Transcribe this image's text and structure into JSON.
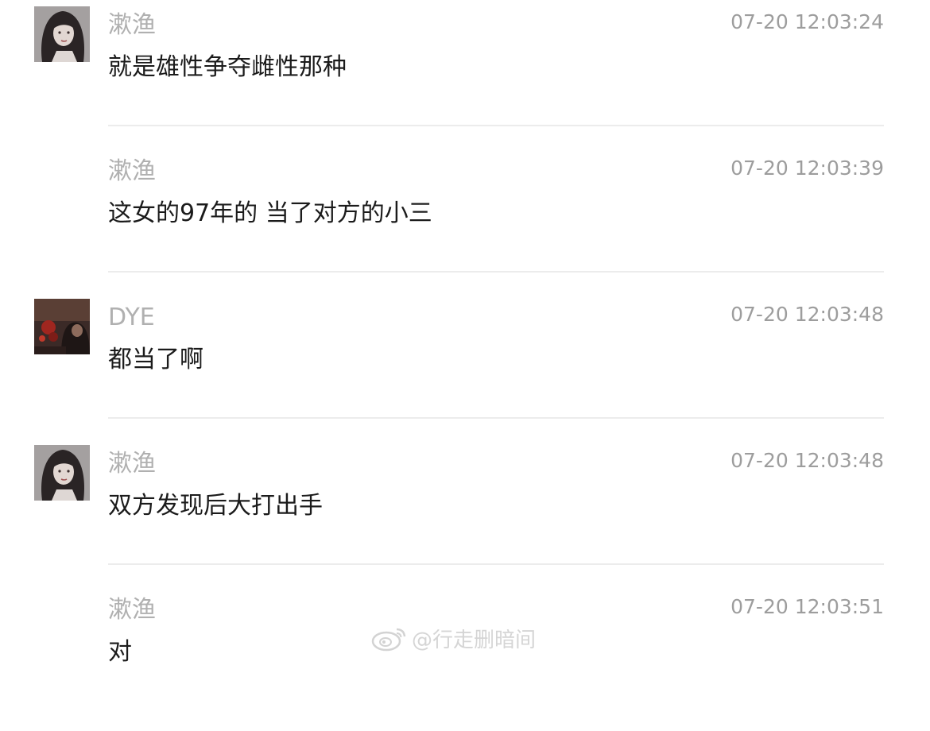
{
  "messages": [
    {
      "sender": "漱渔",
      "time": "07-20 12:03:24",
      "text": "就是雄性争夺雌性那种",
      "avatar": "avatar-dark-hair-woman",
      "show_avatar": true
    },
    {
      "sender": "漱渔",
      "time": "07-20 12:03:39",
      "text": "这女的97年的 当了对方的小三",
      "avatar": "",
      "show_avatar": false
    },
    {
      "sender": "DYE",
      "time": "07-20 12:03:48",
      "text": "都当了啊",
      "avatar": "avatar-dark-reddish-photo",
      "show_avatar": true
    },
    {
      "sender": "漱渔",
      "time": "07-20 12:03:48",
      "text": "双方发现后大打出手",
      "avatar": "avatar-dark-hair-woman",
      "show_avatar": true
    },
    {
      "sender": "漱渔",
      "time": "07-20 12:03:51",
      "text": "对",
      "avatar": "",
      "show_avatar": false
    }
  ],
  "watermark": {
    "text": "@行走删暗间",
    "icon": "weibo-logo-icon"
  },
  "colors": {
    "name": "#b0b0b0",
    "time": "#9d9d9d",
    "text": "#1b1b1b",
    "divider": "#ececec",
    "watermark": "#d5d5d5"
  }
}
